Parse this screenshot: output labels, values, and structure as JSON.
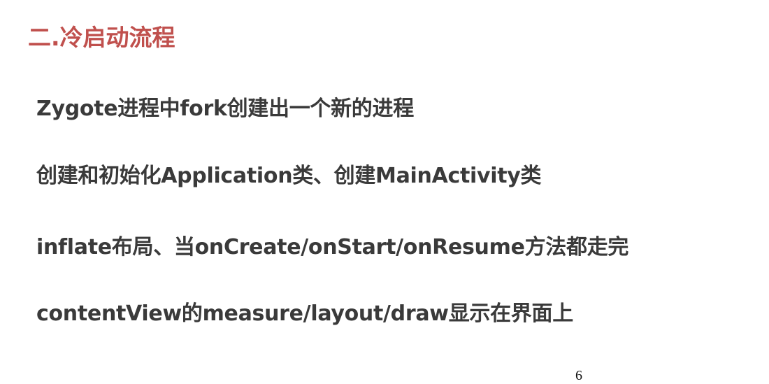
{
  "colors": {
    "title": "#c0504d",
    "body_text": "#3a3a3a",
    "page_number": "#111111"
  },
  "slide": {
    "title": "二.冷启动流程",
    "lines": [
      "Zygote进程中fork创建出一个新的进程",
      "创建和初始化Application类、创建MainActivity类",
      "inflate布局、当onCreate/onStart/onResume方法都走完",
      "contentView的measure/layout/draw显示在界面上"
    ],
    "page_number": "6"
  }
}
